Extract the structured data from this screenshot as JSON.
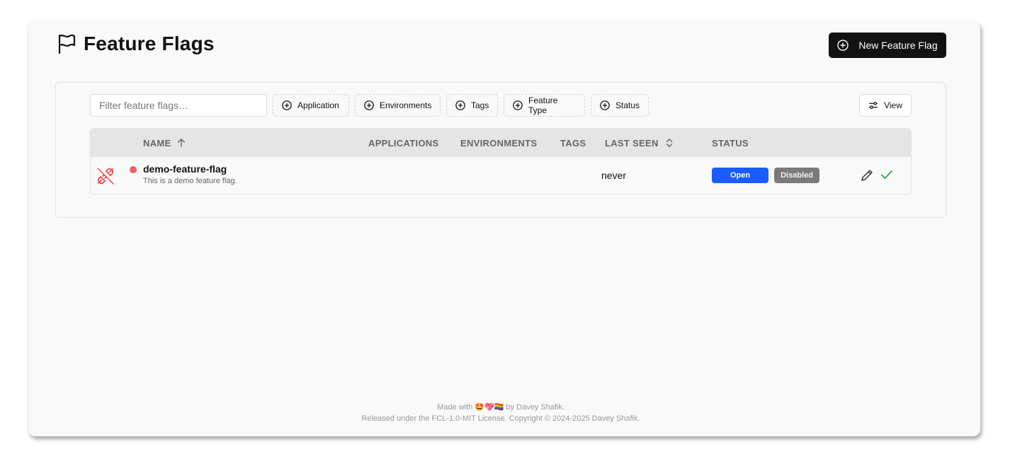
{
  "header": {
    "title": "Feature Flags",
    "new_button_label": "New Feature Flag"
  },
  "toolbar": {
    "filter_placeholder": "Filter feature flags…",
    "chips": [
      "Application",
      "Environments",
      "Tags",
      "Feature Type",
      "Status"
    ],
    "view_label": "View"
  },
  "table": {
    "columns": {
      "name": "NAME",
      "applications": "APPLICATIONS",
      "environments": "ENVIRONMENTS",
      "tags": "TAGS",
      "last_seen": "LAST SEEN",
      "status": "STATUS"
    },
    "rows": [
      {
        "name": "demo-feature-flag",
        "description": "This is a demo feature flag.",
        "last_seen": "never",
        "status_open": "Open",
        "status_disabled": "Disabled"
      }
    ]
  },
  "footer": {
    "line1": "Made with 🤩💖🏳️‍🌈 by Davey Shafik.",
    "line2": "Released under the FCL-1.0-MIT License. Copyright © 2024-2025 Davey Shafik."
  },
  "colors": {
    "accent": "#1b5cff",
    "danger": "#ef6060",
    "success": "#22a34a",
    "primary_button": "#121212"
  },
  "icons": [
    "flag-icon",
    "plus-circle-icon",
    "sliders-icon",
    "sort-asc-icon",
    "sort-both-icon",
    "plug-disconnected-icon",
    "pencil-icon",
    "check-icon"
  ]
}
